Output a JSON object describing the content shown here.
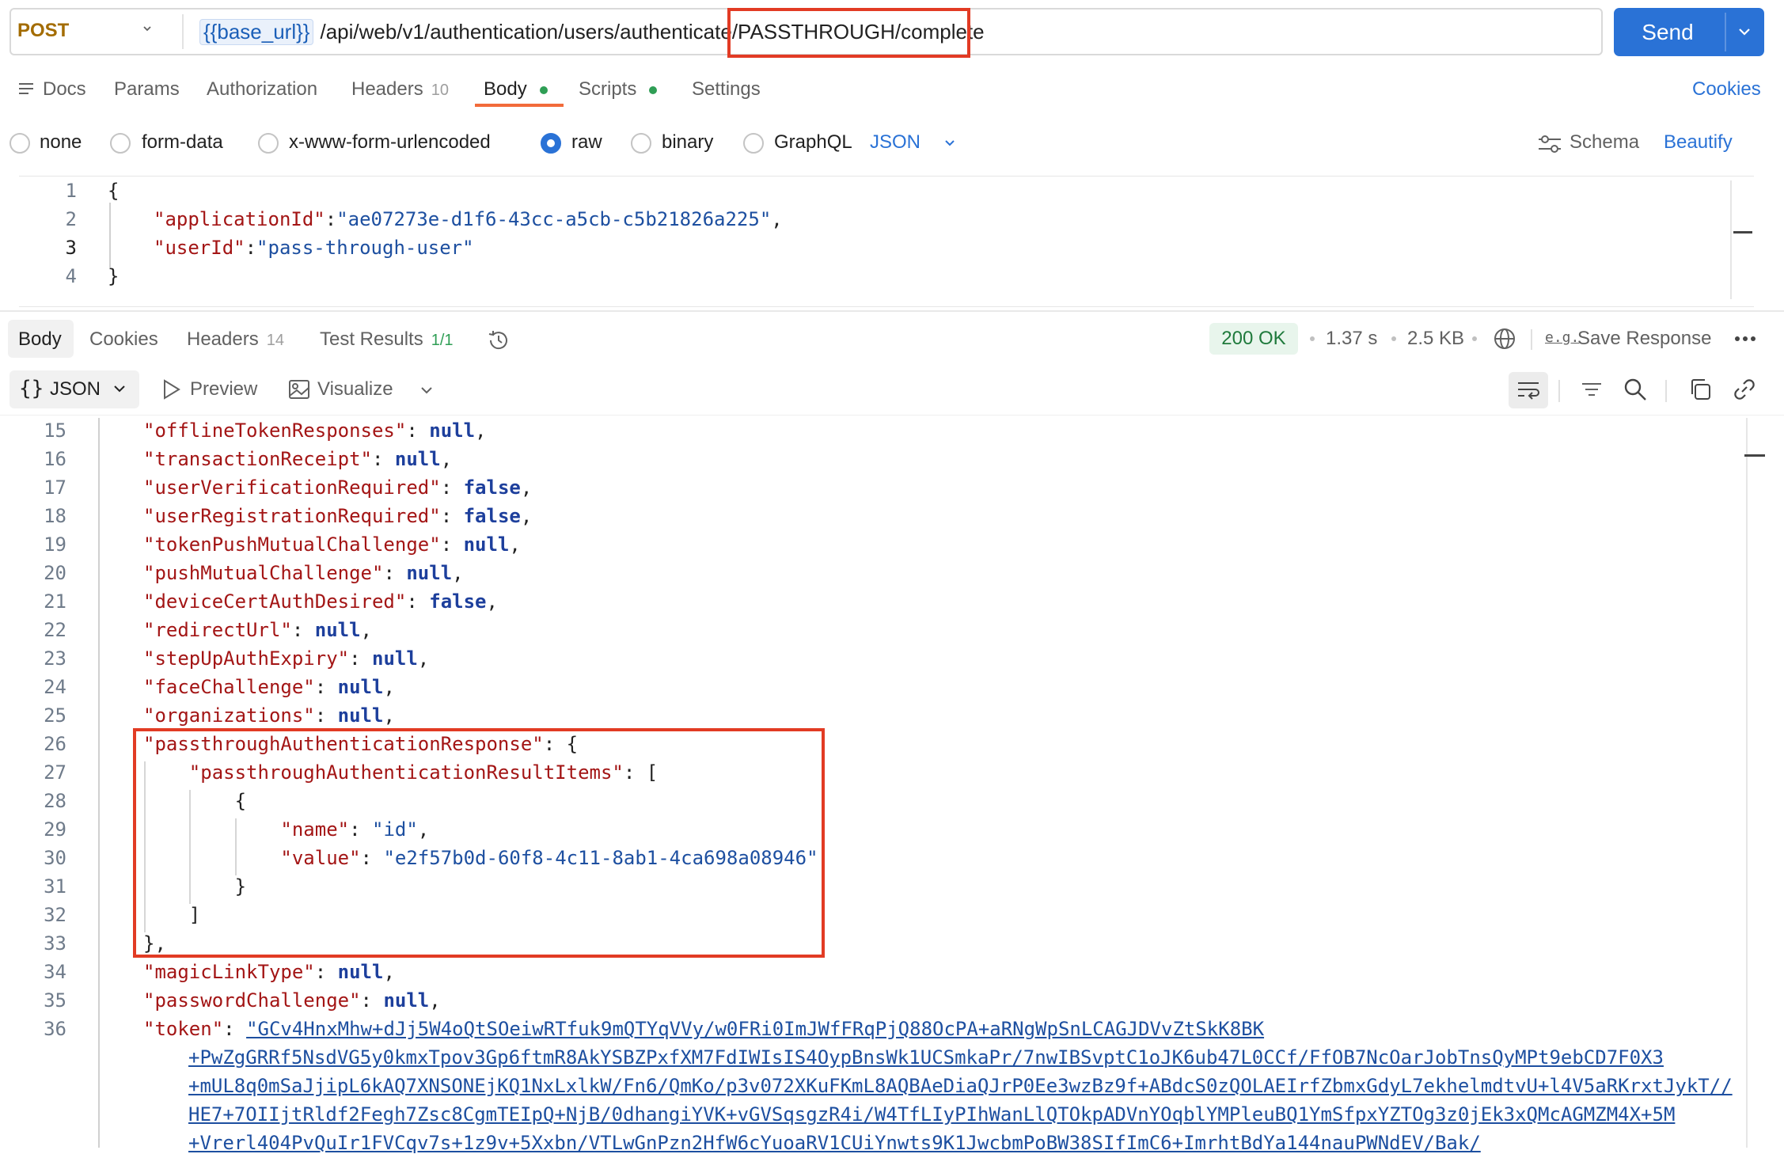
{
  "request": {
    "method": "POST",
    "url_variable": "{{base_url}}",
    "url_path_prefix": "/api/web/v1/authentication/users/authenticate",
    "url_path_highlight": "/PASSTHROUGH/complete",
    "send_label": "Send"
  },
  "request_tabs": [
    {
      "label": "Docs"
    },
    {
      "label": "Params"
    },
    {
      "label": "Authorization"
    },
    {
      "label": "Headers",
      "count": "10"
    },
    {
      "label": "Body",
      "active": true,
      "dot": true
    },
    {
      "label": "Scripts",
      "dot": true
    },
    {
      "label": "Settings"
    }
  ],
  "cookies_link": "Cookies",
  "body_types": [
    "none",
    "form-data",
    "x-www-form-urlencoded",
    "raw",
    "binary",
    "GraphQL"
  ],
  "body_type_selected": "raw",
  "body_format": "JSON",
  "schema_label": "Schema",
  "beautify_label": "Beautify",
  "request_body": {
    "line_numbers": [
      "1",
      "2",
      "3",
      "4"
    ],
    "open_brace": "{",
    "close_brace": "}",
    "fields": [
      {
        "key": "\"applicationId\"",
        "value": "\"ae07273e-d1f6-43cc-a5cb-c5b21826a225\"",
        "trail": ","
      },
      {
        "key": "\"userId\"",
        "value": "\"pass-through-user\"",
        "trail": ""
      }
    ]
  },
  "response_tabs": [
    {
      "label": "Body",
      "active": true
    },
    {
      "label": "Cookies"
    },
    {
      "label": "Headers",
      "count": "14"
    },
    {
      "label": "Test Results",
      "count": "1/1"
    }
  ],
  "response_meta": {
    "status": "200 OK",
    "time": "1.37 s",
    "size": "2.5 KB",
    "save_response": "Save Response"
  },
  "response_view": {
    "format": "JSON",
    "preview": "Preview",
    "visualize": "Visualize"
  },
  "response_body": {
    "lines": [
      {
        "n": "15",
        "indent": 1,
        "key": "\"offlineTokenResponses\"",
        "val": "null",
        "type": "kw",
        "trail": ","
      },
      {
        "n": "16",
        "indent": 1,
        "key": "\"transactionReceipt\"",
        "val": "null",
        "type": "kw",
        "trail": ","
      },
      {
        "n": "17",
        "indent": 1,
        "key": "\"userVerificationRequired\"",
        "val": "false",
        "type": "kw",
        "trail": ","
      },
      {
        "n": "18",
        "indent": 1,
        "key": "\"userRegistrationRequired\"",
        "val": "false",
        "type": "kw",
        "trail": ","
      },
      {
        "n": "19",
        "indent": 1,
        "key": "\"tokenPushMutualChallenge\"",
        "val": "null",
        "type": "kw",
        "trail": ","
      },
      {
        "n": "20",
        "indent": 1,
        "key": "\"pushMutualChallenge\"",
        "val": "null",
        "type": "kw",
        "trail": ","
      },
      {
        "n": "21",
        "indent": 1,
        "key": "\"deviceCertAuthDesired\"",
        "val": "false",
        "type": "kw",
        "trail": ","
      },
      {
        "n": "22",
        "indent": 1,
        "key": "\"redirectUrl\"",
        "val": "null",
        "type": "kw",
        "trail": ","
      },
      {
        "n": "23",
        "indent": 1,
        "key": "\"stepUpAuthExpiry\"",
        "val": "null",
        "type": "kw",
        "trail": ","
      },
      {
        "n": "24",
        "indent": 1,
        "key": "\"faceChallenge\"",
        "val": "null",
        "type": "kw",
        "trail": ","
      },
      {
        "n": "25",
        "indent": 1,
        "key": "\"organizations\"",
        "val": "null",
        "type": "kw",
        "trail": ","
      },
      {
        "n": "26",
        "indent": 1,
        "key": "\"passthroughAuthenticationResponse\"",
        "val": "{",
        "type": "plain",
        "trail": ""
      },
      {
        "n": "27",
        "indent": 2,
        "key": "\"passthroughAuthenticationResultItems\"",
        "val": "[",
        "type": "plain",
        "trail": ""
      },
      {
        "n": "28",
        "indent": 3,
        "key": "",
        "val": "{",
        "type": "plain",
        "trail": ""
      },
      {
        "n": "29",
        "indent": 4,
        "key": "\"name\"",
        "val": "\"id\"",
        "type": "s",
        "trail": ","
      },
      {
        "n": "30",
        "indent": 4,
        "key": "\"value\"",
        "val": "\"e2f57b0d-60f8-4c11-8ab1-4ca698a08946\"",
        "type": "s",
        "trail": ""
      },
      {
        "n": "31",
        "indent": 3,
        "key": "",
        "val": "}",
        "type": "plain",
        "trail": ""
      },
      {
        "n": "32",
        "indent": 2,
        "key": "",
        "val": "]",
        "type": "plain",
        "trail": ""
      },
      {
        "n": "33",
        "indent": 1,
        "key": "",
        "val": "}",
        "type": "plain",
        "trail": ","
      },
      {
        "n": "34",
        "indent": 1,
        "key": "\"magicLinkType\"",
        "val": "null",
        "type": "kw",
        "trail": ","
      },
      {
        "n": "35",
        "indent": 1,
        "key": "\"passwordChallenge\"",
        "val": "null",
        "type": "kw",
        "trail": ","
      },
      {
        "n": "36",
        "indent": 1,
        "key": "\"token\"",
        "val": "\"GCv4HnxMhw+dJj5W4oQtSOeiwRTfuk9mQTYqVVy/w0FRi0ImJWfFRqPjQ88OcPA+aRNgWpSnLCAGJDVvZtSkK8BK",
        "type": "tok",
        "trail": ""
      }
    ],
    "token_continuation": [
      "+PwZgGRRf5NsdVG5y0kmxTpov3Gp6ftmR8AkYSBZPxfXM7FdIWIsIS4OypBnsWk1UCSmkaPr/7nwIBSvptC1oJK6ub47L0CCf/FfOB7NcOarJobTnsQyMPt9ebCD7F0X3",
      "+mUL8q0mSaJjipL6kAQ7XNSONEjKQ1NxLxlkW/Fn6/QmKo/p3v072XKuFKmL8AQBAeDiaQJrP0Ee3wzBz9f+ABdcS0zQOLAEIrfZbmxGdyL7ekhelmdtvU+l4V5aRKrxtJykT//",
      "HE7+7OIIjtRldf2Fegh7Zsc8CgmTEIpQ+NjB/0dhangiYVK+vGVSqsgzR4i/W4TfLIyPIhWanLlQTOkpADVnYOqblYMPleuBQ1YmSfpxYZTOg3z0jEk3xQMcAGMZM4X+5M",
      "+Vrerl404PvQuIr1FVCqv7s+1z9v+5Xxbn/VTLwGnPzn2HfW6cYuoaRV1CUiYnwts9K1JwcbmPoBW38SIfImC6+ImrhtBdYa144nauPWNdEV/Bak/"
    ]
  },
  "colors": {
    "accent": "#2a72d6",
    "highlight_box": "#e23b24",
    "json_key": "#a31515",
    "json_string": "#1d4fa0",
    "json_keyword": "#1d3f9c",
    "status_ok": "#1f7a3c",
    "method_post": "#a36c00",
    "tab_active_underline": "#f26b3a"
  },
  "icons": [
    "chevron-down-icon",
    "docs-icon",
    "schema-icon",
    "history-icon",
    "globe-icon",
    "save-response-icon",
    "more-icon",
    "preview-icon",
    "visualize-icon",
    "wrap-icon",
    "filter-icon",
    "search-icon",
    "copy-icon",
    "link-icon"
  ]
}
